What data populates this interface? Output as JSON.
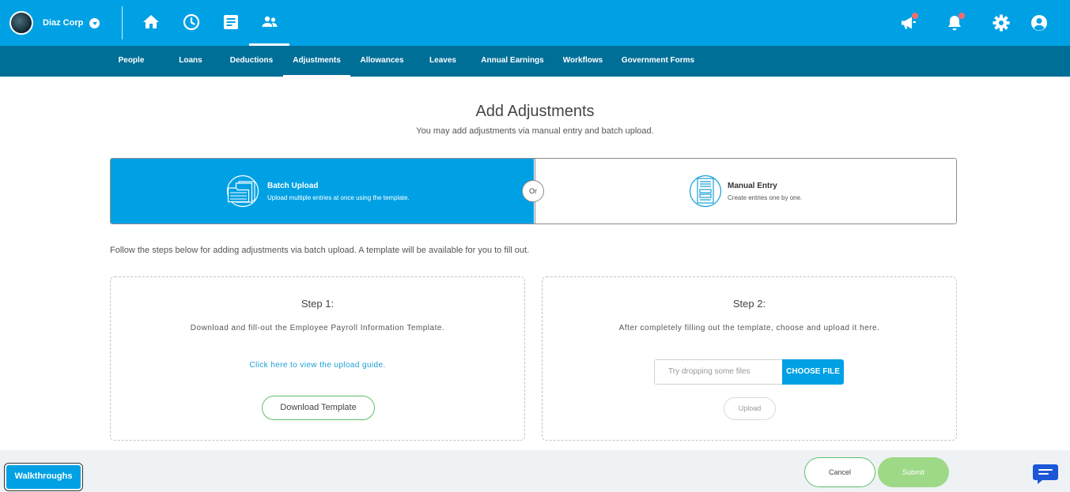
{
  "header": {
    "company_name": "Diaz Corp",
    "nav_icons": [
      "home-icon",
      "clock-icon",
      "document-icon",
      "people-icon"
    ],
    "right_icons": [
      "megaphone-icon",
      "bell-icon",
      "gear-icon",
      "user-icon"
    ]
  },
  "subnav": {
    "items": [
      {
        "label": "People"
      },
      {
        "label": "Loans"
      },
      {
        "label": "Deductions"
      },
      {
        "label": "Adjustments",
        "active": true
      },
      {
        "label": "Allowances"
      },
      {
        "label": "Leaves"
      },
      {
        "label": "Annual Earnings"
      },
      {
        "label": "Workflows"
      },
      {
        "label": "Government Forms"
      }
    ]
  },
  "main": {
    "title": "Add Adjustments",
    "subtitle": "You may add adjustments via manual entry and batch upload.",
    "batch_upload": {
      "title": "Batch Upload",
      "description": "Upload multiple entries at once using the template."
    },
    "or_label": "Or",
    "manual_entry": {
      "title": "Manual Entry",
      "description": "Create entries one by one."
    },
    "instructions": "Follow the steps below for adding adjustments via batch upload. A template will be available for you to fill out.",
    "step1": {
      "title": "Step 1:",
      "description": "Download and fill-out the Employee Payroll Information Template.",
      "guide_link": "Click here to view the upload guide.",
      "download_label": "Download Template"
    },
    "step2": {
      "title": "Step 2:",
      "description": "After completely filling out the template, choose and upload it here.",
      "file_placeholder": "Try dropping some files",
      "choose_label": "CHOOSE FILE",
      "upload_label": "Upload"
    }
  },
  "footer": {
    "walkthroughs_label": "Walkthroughs",
    "cancel_label": "Cancel",
    "submit_label": "Submit"
  },
  "colors": {
    "primary": "#00a1e4",
    "subnav": "#006f98",
    "accent_green": "#5fbf6a",
    "notification_red": "#f26d6d"
  }
}
